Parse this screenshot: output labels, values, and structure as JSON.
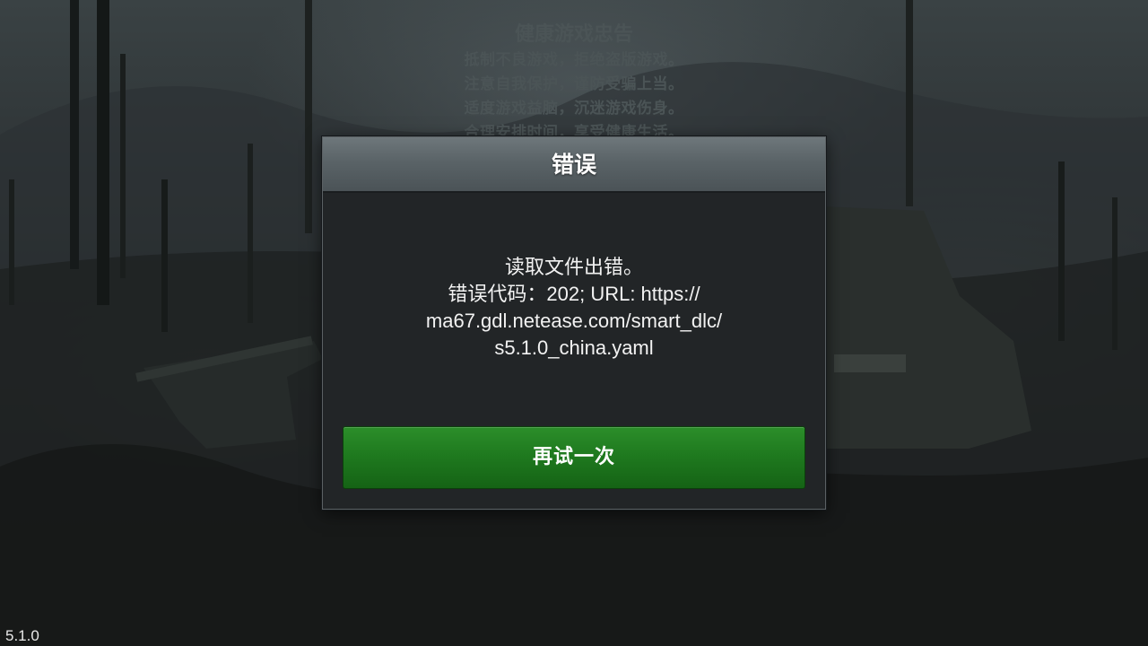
{
  "health_notice": {
    "title": "健康游戏忠告",
    "lines": [
      "抵制不良游戏，拒绝盗版游戏。",
      "注意自我保护，谨防受骗上当。",
      "适度游戏益脑，沉迷游戏伤身。",
      "合理安排时间，享受健康生活。"
    ]
  },
  "dialog": {
    "title": "错误",
    "message_lines": [
      "读取文件出错。",
      "错误代码：202; URL: https://",
      "ma67.gdl.netease.com/smart_dlc/",
      "s5.1.0_china.yaml"
    ],
    "retry_label": "再试一次"
  },
  "version": "5.1.0",
  "colors": {
    "retry_button": "#1f7a1f",
    "dialog_header": "#5a6367",
    "dialog_body": "#222527"
  }
}
